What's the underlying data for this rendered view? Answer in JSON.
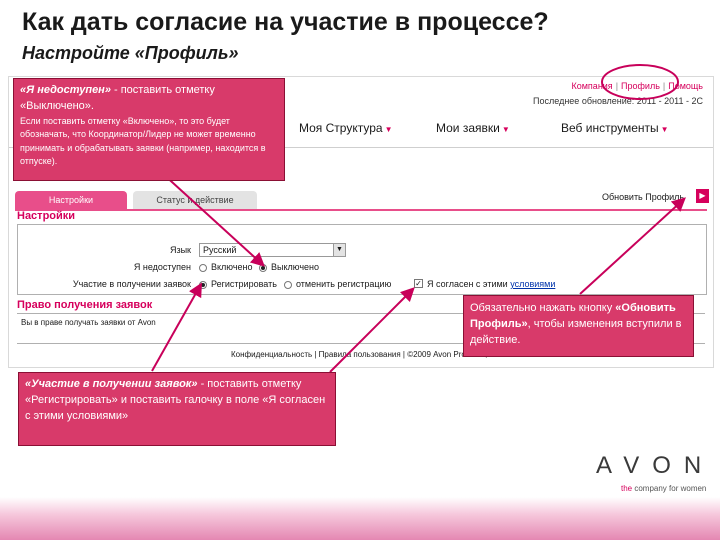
{
  "slide": {
    "title": "Как дать согласие на участие в процессе?",
    "subtitle": "Настройте «Профиль»"
  },
  "screenshot": {
    "top_links": {
      "company": "Компания",
      "profile": "Профиль",
      "help": "Помощь"
    },
    "last_update": "Последнее обновление: 2011 - 2011 - 2С",
    "nav": [
      {
        "label": "Моя Структура"
      },
      {
        "label": "Мои заявки"
      },
      {
        "label": "Веб инструменты"
      }
    ],
    "tabs": {
      "active": "Настройки",
      "inactive": "Статус и действие"
    },
    "refresh_label": "Обновить Профиль",
    "refresh_icon": "play-arrow-icon",
    "settings": {
      "section_title": "Настройки",
      "language_label": "Язык",
      "language_value": "Русский",
      "unavailable_label": "Я недоступен",
      "unavailable_options": [
        "Включено",
        "Выключено"
      ],
      "unavailable_selected": 1,
      "participation_label": "Участие в получении заявок",
      "participation_options": [
        "Регистрировать",
        "отменить регистрацию"
      ],
      "participation_selected": 0,
      "agree_prefix": "Я согласен с этими ",
      "agree_link": "условиями",
      "agree_checked": true
    },
    "rights": {
      "section_title": "Право получения заявок",
      "text": "Вы в праве получать заявки от Avon"
    },
    "footer": "Конфиденциальность | Правила пользования | ©2009 Avon Products, Inc."
  },
  "callouts": {
    "unavailable": {
      "title": "«Я недоступен»",
      "line1": " - поставить отметку «Выключено».",
      "detail": "Если поставить отметку «Включено», то это будет обозначать, что Координатор/Лидер не может временно принимать и обрабатывать заявки (например, находится в отпуске)."
    },
    "refresh": {
      "pre": "Обязательно нажать кнопку ",
      "bold": "«Обновить Профиль»",
      "post": ", чтобы изменения вступили в действие."
    },
    "participation": {
      "title": "«Участие в получении заявок»",
      "rest": " - поставить отметку «Регистрировать» и поставить галочку в поле «Я согласен с этими условиями»"
    }
  },
  "brand": {
    "logo": "AVON",
    "tagline_highlight": "the",
    "tagline_rest": " company for women"
  },
  "colors": {
    "accent": "#d6005c",
    "callout_bg": "#d83a6a"
  }
}
